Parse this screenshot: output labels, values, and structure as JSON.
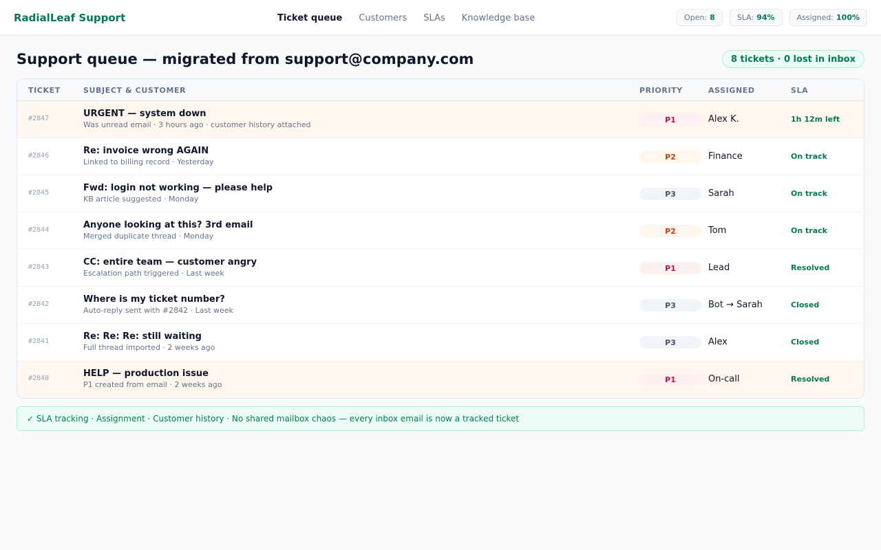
{
  "app": {
    "brand": "RadialLeaf Support"
  },
  "nav": [
    {
      "label": "Ticket queue",
      "active": true
    },
    {
      "label": "Customers",
      "active": false
    },
    {
      "label": "SLAs",
      "active": false
    },
    {
      "label": "Knowledge base",
      "active": false
    }
  ],
  "stats": [
    {
      "label": "Open:",
      "value": "8"
    },
    {
      "label": "SLA:",
      "value": "94%"
    },
    {
      "label": "Assigned:",
      "value": "100%"
    }
  ],
  "page": {
    "title": "Support queue — migrated from support@company.com",
    "summary": "8 tickets · 0 lost in inbox"
  },
  "table": {
    "headers": {
      "ticket": "TICKET",
      "subject": "SUBJECT & CUSTOMER",
      "priority": "PRIORITY",
      "assigned": "ASSIGNED",
      "sla": "SLA"
    },
    "rows": [
      {
        "id": "#2847",
        "subject": "URGENT — system down",
        "detail": "Was unread email · 3 hours ago · customer history attached",
        "priority": "P1",
        "assigned": "Alex K.",
        "sla": "1h 12m left",
        "highlight": true
      },
      {
        "id": "#2846",
        "subject": "Re: invoice wrong AGAIN",
        "detail": "Linked to billing record · Yesterday",
        "priority": "P2",
        "assigned": "Finance",
        "sla": "On track",
        "highlight": false
      },
      {
        "id": "#2845",
        "subject": "Fwd: login not working — please help",
        "detail": "KB article suggested · Monday",
        "priority": "P3",
        "assigned": "Sarah",
        "sla": "On track",
        "highlight": false
      },
      {
        "id": "#2844",
        "subject": "Anyone looking at this? 3rd email",
        "detail": "Merged duplicate thread · Monday",
        "priority": "P2",
        "assigned": "Tom",
        "sla": "On track",
        "highlight": false
      },
      {
        "id": "#2843",
        "subject": "CC: entire team — customer angry",
        "detail": "Escalation path triggered · Last week",
        "priority": "P1",
        "assigned": "Lead",
        "sla": "Resolved",
        "highlight": false
      },
      {
        "id": "#2842",
        "subject": "Where is my ticket number?",
        "detail": "Auto-reply sent with #2842 · Last week",
        "priority": "P3",
        "assigned": "Bot → Sarah",
        "sla": "Closed",
        "highlight": false
      },
      {
        "id": "#2841",
        "subject": "Re: Re: Re: still waiting",
        "detail": "Full thread imported · 2 weeks ago",
        "priority": "P3",
        "assigned": "Alex",
        "sla": "Closed",
        "highlight": false
      },
      {
        "id": "#2840",
        "subject": "HELP — production issue",
        "detail": "P1 created from email · 2 weeks ago",
        "priority": "P1",
        "assigned": "On-call",
        "sla": "Resolved",
        "highlight": true
      }
    ]
  },
  "banner": "✓ SLA tracking · Assignment · Customer history · No shared mailbox chaos — every inbox email is now a tracked ticket",
  "colors": {
    "accent": "#047857",
    "p1": "#be123c",
    "p2": "#c2410c",
    "p3": "#475569"
  }
}
